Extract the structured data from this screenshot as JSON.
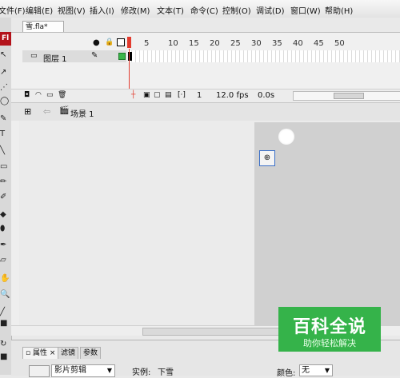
{
  "menu": {
    "items": [
      "文件(F)",
      "编辑(E)",
      "视图(V)",
      "插入(I)",
      "修改(M)",
      "文本(T)",
      "命令(C)",
      "控制(O)",
      "调试(D)",
      "窗口(W)",
      "帮助(H)"
    ]
  },
  "tools": {
    "logo": "Fl",
    "glyphs": [
      "↖",
      "↗",
      "⋰",
      "◯",
      "✎",
      "T",
      "╲",
      "▭",
      "✏",
      "✐",
      "◆",
      "⬮",
      "✒",
      "▱",
      "✋",
      "🔍",
      "╱",
      "■",
      "↻",
      "■"
    ]
  },
  "document": {
    "tab_label": "雪.fla*"
  },
  "timeline": {
    "frame_numbers": [
      "5",
      "10",
      "15",
      "20",
      "25",
      "30",
      "35",
      "40",
      "45",
      "50"
    ],
    "layer": {
      "name": "图层 1"
    },
    "current_frame": "1",
    "fps": "12.0 fps",
    "time": "0.0s"
  },
  "edit_bar": {
    "scene": "场景 1"
  },
  "properties": {
    "tabs": [
      "属性",
      "滤镜",
      "参数"
    ],
    "symbol_type": "影片剪辑",
    "instance_label": "实例:",
    "instance_value": "下雪",
    "color_label": "颜色:",
    "color_value": "无"
  },
  "watermark": {
    "title": "百科全说",
    "subtitle": "助你轻松解决"
  },
  "colors": {
    "logo_red": "#b3121a",
    "watermark_green": "#35b34a",
    "playhead_red": "#e23b2e",
    "work_area": "#d0d0d0"
  }
}
